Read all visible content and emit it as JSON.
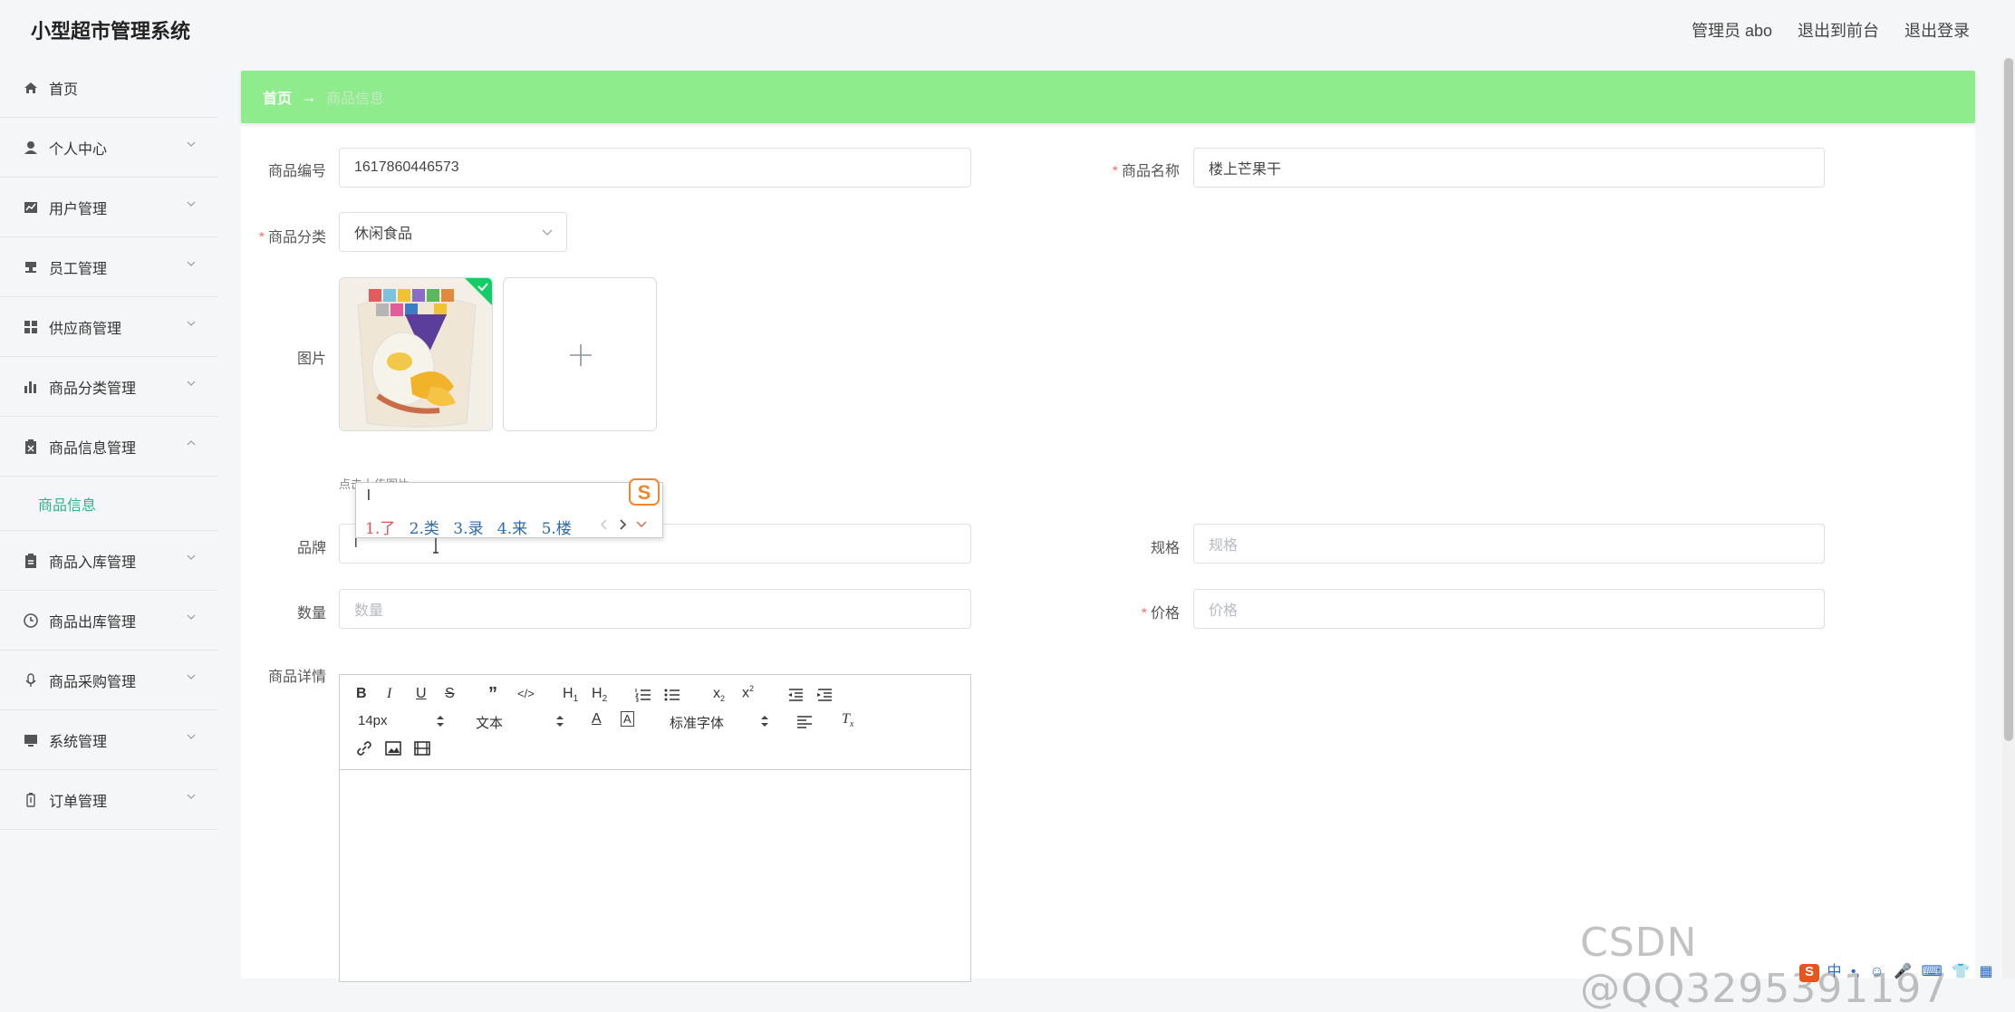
{
  "app": {
    "title": "小型超市管理系统"
  },
  "header": {
    "admin_label": "管理员 abo",
    "to_front": "退出到前台",
    "logout": "退出登录"
  },
  "sidebar": {
    "items": [
      {
        "label": "首页",
        "icon": "home-icon"
      },
      {
        "label": "个人中心",
        "icon": "user-icon"
      },
      {
        "label": "用户管理",
        "icon": "chart-line-icon"
      },
      {
        "label": "员工管理",
        "icon": "stamp-icon"
      },
      {
        "label": "供应商管理",
        "icon": "grid-icon"
      },
      {
        "label": "商品分类管理",
        "icon": "bar-chart-icon"
      },
      {
        "label": "商品信息管理",
        "icon": "clipboard-icon"
      },
      {
        "label": "商品入库管理",
        "icon": "clipboard-icon"
      },
      {
        "label": "商品出库管理",
        "icon": "clock-icon"
      },
      {
        "label": "商品采购管理",
        "icon": "microphone-icon"
      },
      {
        "label": "系统管理",
        "icon": "monitor-icon"
      },
      {
        "label": "订单管理",
        "icon": "battery-icon"
      }
    ],
    "active_sub": "商品信息"
  },
  "breadcrumb": {
    "home": "首页",
    "separator": "→",
    "current": "商品信息"
  },
  "form": {
    "code_label": "商品编号",
    "code_value": "1617860446573",
    "name_label": "商品名称",
    "name_value": "楼上芒果干",
    "category_label": "商品分类",
    "category_value": "休闲食品",
    "image_label": "图片",
    "upload_hint": "点击上传图片",
    "brand_label": "品牌",
    "brand_value": "l",
    "spec_label": "规格",
    "spec_placeholder": "规格",
    "qty_label": "数量",
    "qty_placeholder": "数量",
    "price_label": "价格",
    "price_placeholder": "价格",
    "detail_label": "商品详情"
  },
  "ime": {
    "input": "l",
    "candidates": [
      "1.了",
      "2.类",
      "3.录",
      "4.来",
      "5.楼"
    ]
  },
  "editor": {
    "font_size": "14px",
    "block_type": "文本",
    "font_family": "标准字体"
  },
  "watermark": "CSDN @QQ3295391197",
  "tray_text": "中"
}
